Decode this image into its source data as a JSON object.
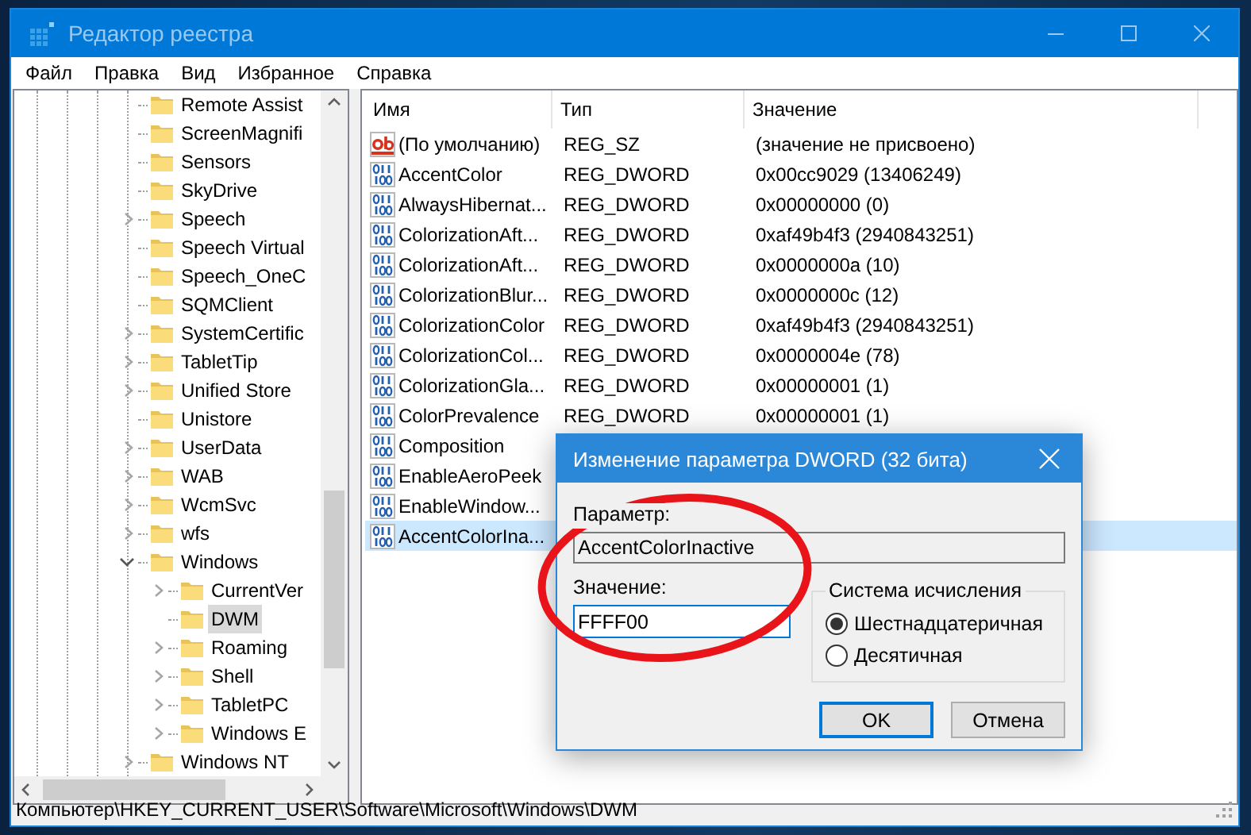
{
  "window": {
    "title": "Редактор реестра"
  },
  "menu": [
    "Файл",
    "Правка",
    "Вид",
    "Избранное",
    "Справка"
  ],
  "tree": [
    {
      "label": "Remote Assist",
      "selected": false
    },
    {
      "label": "ScreenMagnifi",
      "selected": false
    },
    {
      "label": "Sensors",
      "selected": false
    },
    {
      "label": "SkyDrive",
      "selected": false
    },
    {
      "label": "Speech",
      "expanded": false,
      "selected": false
    },
    {
      "label": "Speech Virtual",
      "selected": false
    },
    {
      "label": "Speech_OneC",
      "selected": false
    },
    {
      "label": "SQMClient",
      "selected": false
    },
    {
      "label": "SystemCertific",
      "expanded": false,
      "selected": false
    },
    {
      "label": "TabletTip",
      "expanded": false,
      "selected": false
    },
    {
      "label": "Unified Store",
      "expanded": false,
      "selected": false
    },
    {
      "label": "Unistore",
      "selected": false
    },
    {
      "label": "UserData",
      "expanded": false,
      "selected": false
    },
    {
      "label": "WAB",
      "expanded": false,
      "selected": false
    },
    {
      "label": "WcmSvc",
      "expanded": false,
      "selected": false
    },
    {
      "label": "wfs",
      "expanded": false,
      "selected": false
    },
    {
      "label": "Windows",
      "expanded": true,
      "selected": false,
      "children": [
        {
          "label": "CurrentVer",
          "expanded": false,
          "selected": false
        },
        {
          "label": "DWM",
          "selected": true
        },
        {
          "label": "Roaming",
          "expanded": false,
          "selected": false
        },
        {
          "label": "Shell",
          "expanded": false,
          "selected": false
        },
        {
          "label": "TabletPC",
          "expanded": false,
          "selected": false
        },
        {
          "label": "Windows E",
          "expanded": false,
          "selected": false
        }
      ]
    },
    {
      "label": "Windows NT",
      "expanded": false,
      "selected": false
    }
  ],
  "list": {
    "columns": [
      "Имя",
      "Тип",
      "Значение"
    ],
    "rows": [
      {
        "kind": "string",
        "name": "(По умолчанию)",
        "type": "REG_SZ",
        "value": "(значение не присвоено)",
        "selected": false
      },
      {
        "kind": "dword",
        "name": "AccentColor",
        "type": "REG_DWORD",
        "value": "0x00cc9029 (13406249)",
        "selected": false
      },
      {
        "kind": "dword",
        "name": "AlwaysHibernat...",
        "type": "REG_DWORD",
        "value": "0x00000000 (0)",
        "selected": false
      },
      {
        "kind": "dword",
        "name": "ColorizationAft...",
        "type": "REG_DWORD",
        "value": "0xaf49b4f3 (2940843251)",
        "selected": false
      },
      {
        "kind": "dword",
        "name": "ColorizationAft...",
        "type": "REG_DWORD",
        "value": "0x0000000a (10)",
        "selected": false
      },
      {
        "kind": "dword",
        "name": "ColorizationBlur...",
        "type": "REG_DWORD",
        "value": "0x0000000c (12)",
        "selected": false
      },
      {
        "kind": "dword",
        "name": "ColorizationColor",
        "type": "REG_DWORD",
        "value": "0xaf49b4f3 (2940843251)",
        "selected": false
      },
      {
        "kind": "dword",
        "name": "ColorizationCol...",
        "type": "REG_DWORD",
        "value": "0x0000004e (78)",
        "selected": false
      },
      {
        "kind": "dword",
        "name": "ColorizationGla...",
        "type": "REG_DWORD",
        "value": "0x00000001 (1)",
        "selected": false
      },
      {
        "kind": "dword",
        "name": "ColorPrevalence",
        "type": "REG_DWORD",
        "value": "0x00000001 (1)",
        "selected": false
      },
      {
        "kind": "dword",
        "name": "Composition",
        "selected": false
      },
      {
        "kind": "dword",
        "name": "EnableAeroPeek",
        "selected": false
      },
      {
        "kind": "dword",
        "name": "EnableWindow...",
        "selected": false
      },
      {
        "kind": "dword",
        "name": "AccentColorIna...",
        "selected": true
      }
    ]
  },
  "dialog": {
    "title": "Изменение параметра DWORD (32 бита)",
    "name_label": "Параметр:",
    "name_value": "AccentColorInactive",
    "value_label": "Значение:",
    "value": "FFFF00",
    "base_group": {
      "title": "Система исчисления",
      "options": [
        {
          "label": "Шестнадцатеричная",
          "selected": true
        },
        {
          "label": "Десятичная",
          "selected": false
        }
      ]
    },
    "buttons": [
      {
        "label": "OK",
        "default": true
      },
      {
        "label": "Отмена",
        "default": false
      }
    ]
  },
  "status_bar": "Компьютер\\HKEY_CURRENT_USER\\Software\\Microsoft\\Windows\\DWM"
}
